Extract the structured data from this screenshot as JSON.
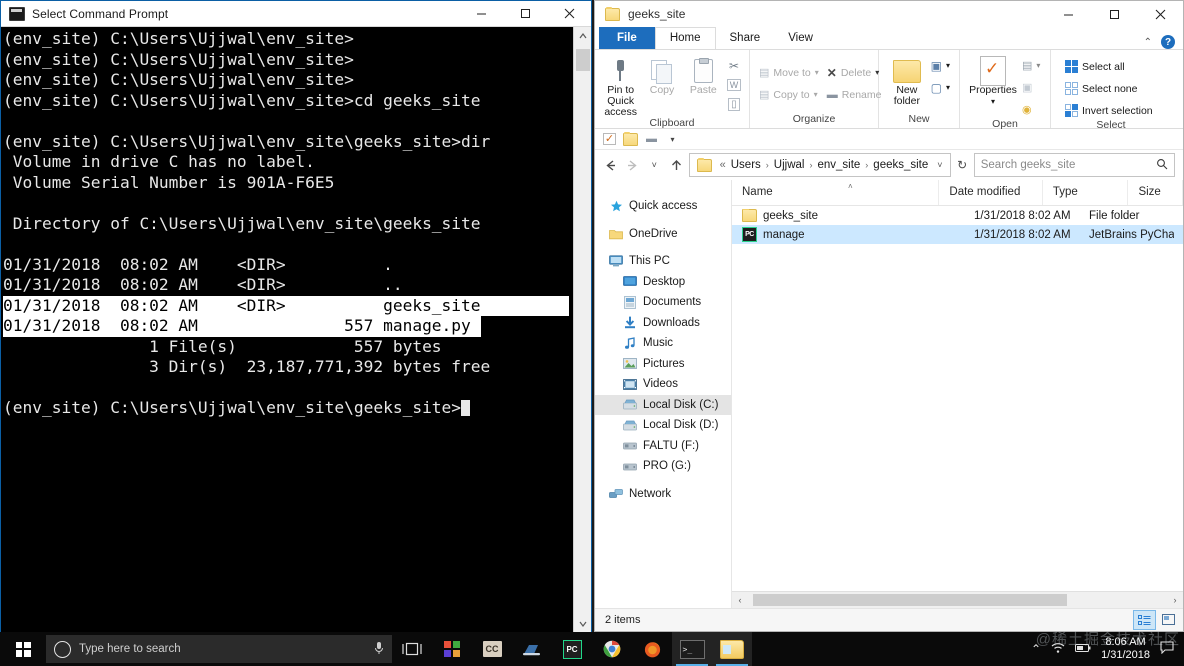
{
  "cmd": {
    "title": "Select Command Prompt",
    "controls": {
      "minimize": "─",
      "maximize": "□",
      "close": "✕"
    },
    "lines": [
      {
        "text": "(env_site) C:\\Users\\Ujjwal\\env_site>",
        "selected": "none"
      },
      {
        "text": "(env_site) C:\\Users\\Ujjwal\\env_site>",
        "selected": "none"
      },
      {
        "text": "(env_site) C:\\Users\\Ujjwal\\env_site>",
        "selected": "none"
      },
      {
        "text": "(env_site) C:\\Users\\Ujjwal\\env_site>cd geeks_site",
        "selected": "none"
      },
      {
        "text": "",
        "selected": "none"
      },
      {
        "text": "(env_site) C:\\Users\\Ujjwal\\env_site\\geeks_site>dir",
        "selected": "none"
      },
      {
        "text": " Volume in drive C has no label.",
        "selected": "none"
      },
      {
        "text": " Volume Serial Number is 901A-F6E5",
        "selected": "none"
      },
      {
        "text": "",
        "selected": "none"
      },
      {
        "text": " Directory of C:\\Users\\Ujjwal\\env_site\\geeks_site",
        "selected": "none"
      },
      {
        "text": "",
        "selected": "none"
      },
      {
        "text": "01/31/2018  08:02 AM    <DIR>          .",
        "selected": "none"
      },
      {
        "text": "01/31/2018  08:02 AM    <DIR>          ..",
        "selected": "none"
      },
      {
        "text": "01/31/2018  08:02 AM    <DIR>          geeks_site",
        "selected": "full"
      },
      {
        "text": "01/31/2018  08:02 AM               557 manage.py",
        "selected": "partial"
      },
      {
        "text": "               1 File(s)            557 bytes",
        "selected": "none"
      },
      {
        "text": "               3 Dir(s)  23,187,771,392 bytes free",
        "selected": "none"
      },
      {
        "text": "",
        "selected": "none"
      },
      {
        "text": "(env_site) C:\\Users\\Ujjwal\\env_site\\geeks_site>",
        "selected": "cursor"
      }
    ]
  },
  "explorer": {
    "title": "geeks_site",
    "controls": {
      "minimize": "─",
      "maximize": "□",
      "close": "✕"
    },
    "help_label": "?",
    "collapse_ribbon": "⌃",
    "tabs": [
      {
        "label": "File",
        "kind": "file"
      },
      {
        "label": "Home",
        "kind": "active"
      },
      {
        "label": "Share",
        "kind": "normal"
      },
      {
        "label": "View",
        "kind": "normal"
      }
    ],
    "ribbon": {
      "clipboard": {
        "group_label": "Clipboard",
        "pin_label": "Pin to Quick access",
        "copy_label": "Copy",
        "paste_label": "Paste",
        "cut_icon": "✂",
        "copy_path_icon": "⎘",
        "paste_shortcut_icon": "▤"
      },
      "organize": {
        "group_label": "Organize",
        "move_to": "Move to",
        "copy_to": "Copy to",
        "delete": "Delete",
        "rename": "Rename",
        "caret": "▾"
      },
      "new": {
        "group_label": "New",
        "new_folder": "New folder",
        "new_item_caret": "▾",
        "easy_access_caret": "▾"
      },
      "open": {
        "group_label": "Open",
        "properties": "Properties",
        "properties_caret": "▾"
      },
      "select": {
        "group_label": "Select",
        "select_all": "Select all",
        "select_none": "Select none",
        "invert_selection": "Invert selection"
      }
    },
    "quick_access": {
      "properties_icon": "properties-icon",
      "new_folder_icon": "new-folder-icon",
      "rename_icon": "rename-icon",
      "customize_caret": "▾"
    },
    "address": {
      "back": "←",
      "forward": "→",
      "recent_caret": "˅",
      "up": "↑",
      "overflow": "«",
      "crumbs": [
        "Users",
        "Ujjwal",
        "env_site",
        "geeks_site"
      ],
      "separator": "›",
      "dropdown_caret": "˅",
      "refresh": "↻",
      "search_placeholder": "Search geeks_site",
      "search_value": ""
    },
    "nav_pane": [
      {
        "label": "Quick access",
        "icon": "star-icon",
        "level": 0,
        "selected": false
      },
      {
        "label": "OneDrive",
        "icon": "onedrive-folder-icon",
        "level": 0,
        "selected": false
      },
      {
        "label": "This PC",
        "icon": "this-pc-icon",
        "level": 0,
        "selected": false
      },
      {
        "label": "Desktop",
        "icon": "desktop-icon",
        "level": 1,
        "selected": false
      },
      {
        "label": "Documents",
        "icon": "documents-icon",
        "level": 1,
        "selected": false
      },
      {
        "label": "Downloads",
        "icon": "downloads-icon",
        "level": 1,
        "selected": false
      },
      {
        "label": "Music",
        "icon": "music-icon",
        "level": 1,
        "selected": false
      },
      {
        "label": "Pictures",
        "icon": "pictures-icon",
        "level": 1,
        "selected": false
      },
      {
        "label": "Videos",
        "icon": "videos-icon",
        "level": 1,
        "selected": false
      },
      {
        "label": "Local Disk (C:)",
        "icon": "drive-icon",
        "level": 1,
        "selected": true
      },
      {
        "label": "Local Disk (D:)",
        "icon": "drive-icon",
        "level": 1,
        "selected": false
      },
      {
        "label": "FALTU (F:)",
        "icon": "removable-drive-icon",
        "level": 1,
        "selected": false
      },
      {
        "label": "PRO (G:)",
        "icon": "removable-drive-icon",
        "level": 1,
        "selected": false
      },
      {
        "label": "Network",
        "icon": "network-icon",
        "level": 0,
        "selected": false
      }
    ],
    "columns": [
      "Name",
      "Date modified",
      "Type",
      "Size"
    ],
    "sort_indicator": "˄",
    "files": [
      {
        "name": "geeks_site",
        "date": "1/31/2018 8:02 AM",
        "type": "File folder",
        "icon": "folder-icon",
        "selected": false
      },
      {
        "name": "manage",
        "date": "1/31/2018 8:02 AM",
        "type": "JetBrains PyChar...",
        "icon": "pycharm-icon",
        "selected": true
      }
    ],
    "status": {
      "item_count": "2 items"
    },
    "view_buttons": {
      "details": "details-view-icon",
      "large_icons": "large-icons-view-icon"
    },
    "hscroll": {
      "left": "‹",
      "right": "›"
    }
  },
  "taskbar": {
    "start": "start-button",
    "search_placeholder": "Type here to search",
    "mic_icon": "microphone-icon",
    "taskview_icon": "task-view-icon",
    "apps": [
      {
        "name": "microsoft-store",
        "label": ""
      },
      {
        "name": "camtasia",
        "label": "CC"
      },
      {
        "name": "teamviewer",
        "label": ""
      },
      {
        "name": "pycharm",
        "label": "PC"
      },
      {
        "name": "chrome",
        "label": ""
      },
      {
        "name": "firefox",
        "label": ""
      },
      {
        "name": "command-prompt",
        "label": "",
        "active": true
      },
      {
        "name": "file-explorer",
        "label": "",
        "active": true
      }
    ],
    "tray": {
      "overflow": "⌃",
      "wifi": "wifi-icon",
      "battery": "battery-icon",
      "action_center": "action-center-icon"
    },
    "clock": {
      "time": "8:06 AM",
      "date": "1/31/2018"
    },
    "watermark": "@稀土掘金技术社区"
  }
}
